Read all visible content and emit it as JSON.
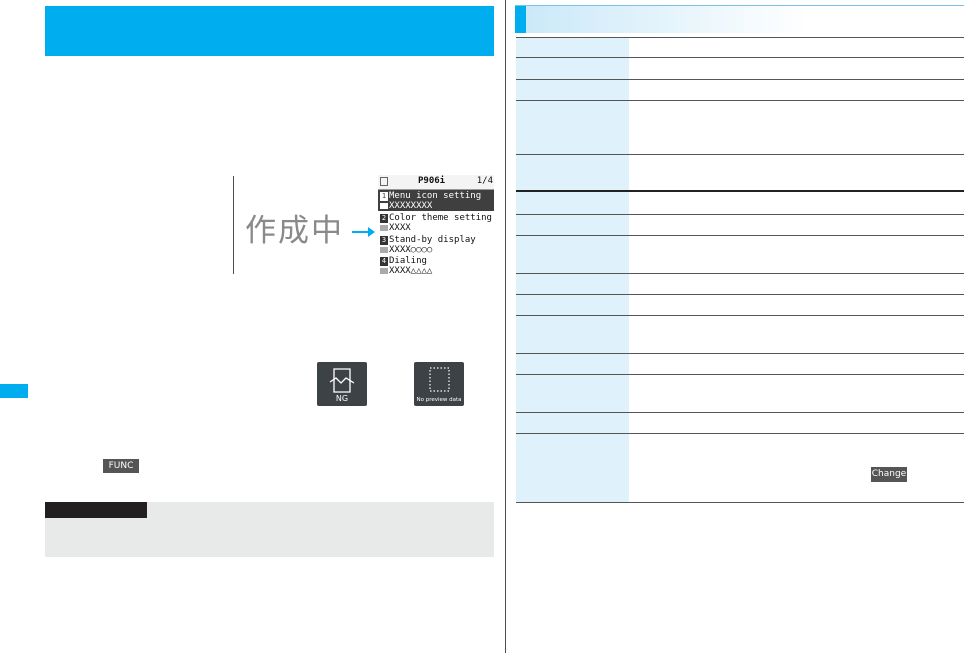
{
  "screen_sample": {
    "overlay_text": "作成中",
    "title": "P906i",
    "page": "1/4",
    "items": [
      {
        "num": "1",
        "label": "Menu icon setting",
        "value": "XXXXXXXX",
        "selected": true
      },
      {
        "num": "2",
        "label": "Color theme setting",
        "value": "XXXX",
        "selected": false
      },
      {
        "num": "3",
        "label": "Stand-by display",
        "value": "XXXX○○○○",
        "selected": false
      },
      {
        "num": "4",
        "label": "Dialing",
        "value": "XXXX△△△△",
        "selected": false
      }
    ]
  },
  "thumbnails": [
    {
      "caption": "NG",
      "icon": "broken-image-icon"
    },
    {
      "caption": "No preview data",
      "icon": "dotted-frame-icon"
    }
  ],
  "keys": {
    "func": "FUNC",
    "change": "Change"
  },
  "colors": {
    "accent": "#00aeef",
    "table_key_bg": "#dff2fc",
    "note_bg": "#e8eaea"
  },
  "table": {
    "row_count": 17
  }
}
